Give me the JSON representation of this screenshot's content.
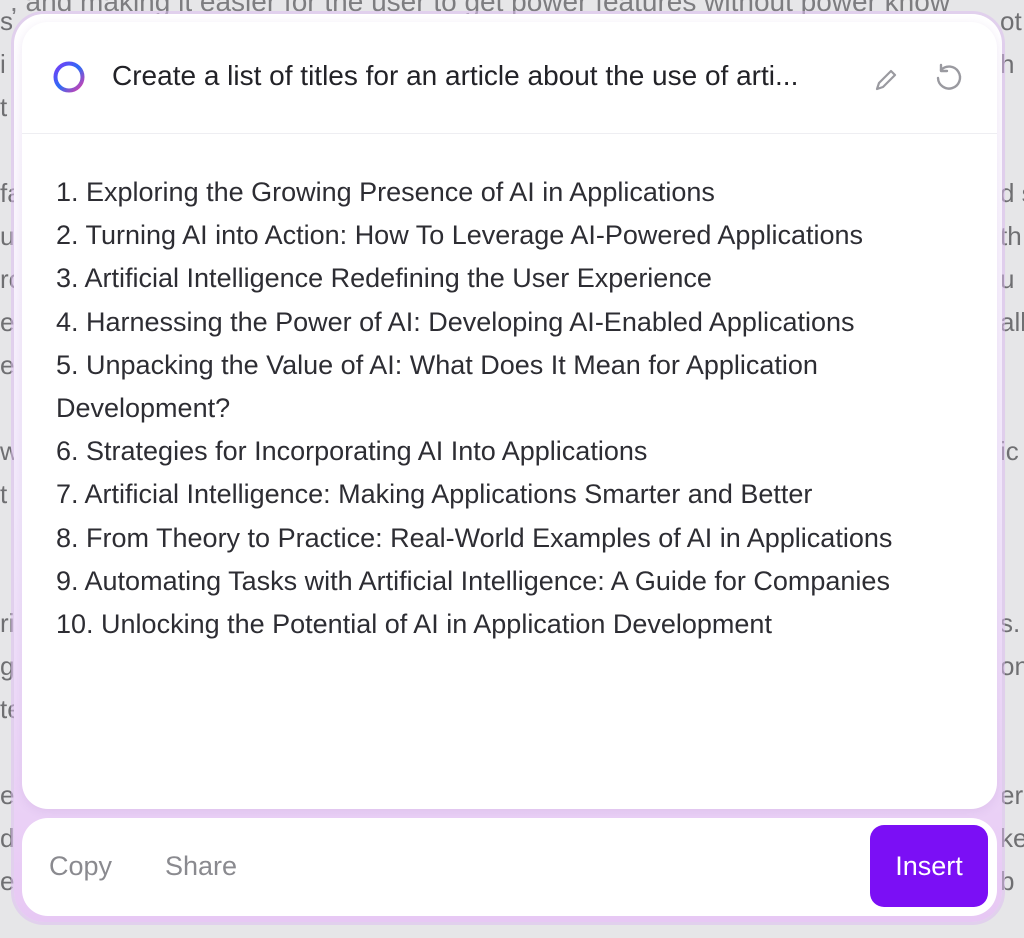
{
  "background": {
    "top_line": ", and making it easier for the user to get power features without power know",
    "left_fragments": [
      "s",
      "i",
      "t",
      "",
      "fa",
      "u",
      "rc",
      "e",
      "e",
      "",
      "w",
      "t",
      "",
      "",
      "ri",
      "g",
      "te",
      "",
      "e",
      "d",
      "e"
    ],
    "right_fragments": [
      "ot",
      "h",
      "",
      "",
      "d s",
      "th",
      "u",
      "all",
      "",
      "",
      "ic",
      "",
      "",
      "",
      "s.",
      "on",
      "",
      "",
      "er",
      "ke",
      "b"
    ]
  },
  "header": {
    "prompt": "Create a list of titles for an article about the use of arti..."
  },
  "results": [
    "1. Exploring the Growing Presence of AI in Applications",
    "2. Turning AI into Action: How To Leverage AI-Powered Applications",
    "3. Artificial Intelligence Redefining the User Experience",
    "4. Harnessing the Power of AI: Developing AI-Enabled Applications",
    "5. Unpacking the Value of AI: What Does It Mean for Application Development?",
    "6. Strategies for Incorporating AI Into Applications",
    "7. Artificial Intelligence: Making Applications Smarter and Better",
    "8. From Theory to Practice: Real-World Examples of AI in Applications",
    "9. Automating Tasks with Artificial Intelligence: A Guide for Companies",
    "10. Unlocking the Potential of AI in Application Development"
  ],
  "footer": {
    "copy_label": "Copy",
    "share_label": "Share",
    "insert_label": "Insert"
  },
  "icons": {
    "ai": "ai-ring-icon",
    "edit": "pencil-icon",
    "regenerate": "refresh-icon"
  },
  "colors": {
    "accent": "#7b0ff5"
  }
}
